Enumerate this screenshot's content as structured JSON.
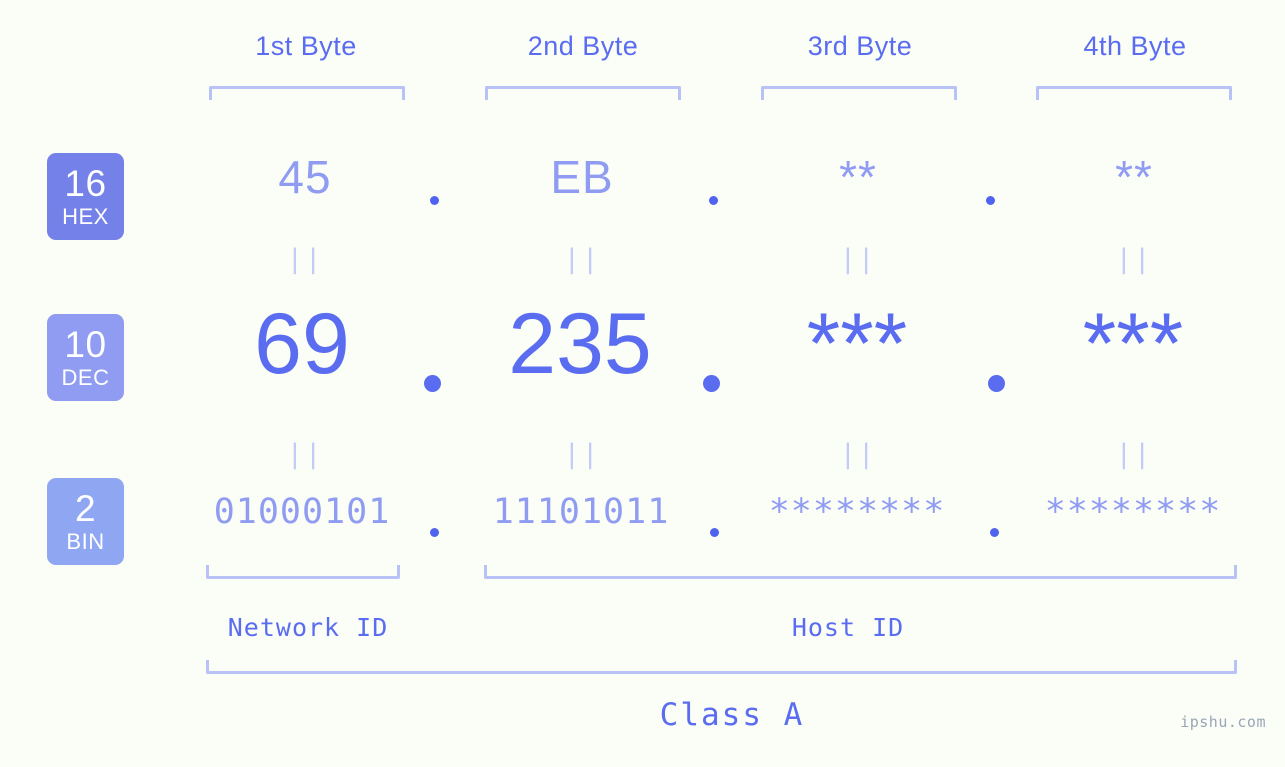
{
  "header": {
    "bytes": [
      {
        "label": "1st Byte"
      },
      {
        "label": "2nd Byte"
      },
      {
        "label": "3rd Byte"
      },
      {
        "label": "4th Byte"
      }
    ]
  },
  "colors": {
    "background": "#fbfdf7",
    "accent_strong": "#5a6cf0",
    "accent_mid": "#8f9cf2",
    "accent_light": "#b9c2f7",
    "badge_hex": "#7481e8",
    "badge_dec": "#8f9cf2",
    "badge_bin": "#8fa6f2",
    "watermark": "#9aa6b8"
  },
  "rows": {
    "hex": {
      "badge_number": "16",
      "badge_name": "HEX",
      "values": [
        "45",
        "EB",
        "**",
        "**"
      ],
      "separator": "."
    },
    "dec": {
      "badge_number": "10",
      "badge_name": "DEC",
      "values": [
        "69",
        "235",
        "***",
        "***"
      ],
      "separator": "."
    },
    "bin": {
      "badge_number": "2",
      "badge_name": "BIN",
      "values": [
        "01000101",
        "11101011",
        "********",
        "********"
      ],
      "separator": "."
    }
  },
  "connectors": {
    "symbol": "||",
    "count_per_row": 4
  },
  "footer": {
    "network_id_label": "Network ID",
    "host_id_label": "Host ID",
    "class_label": "Class A",
    "watermark": "ipshu.com"
  }
}
